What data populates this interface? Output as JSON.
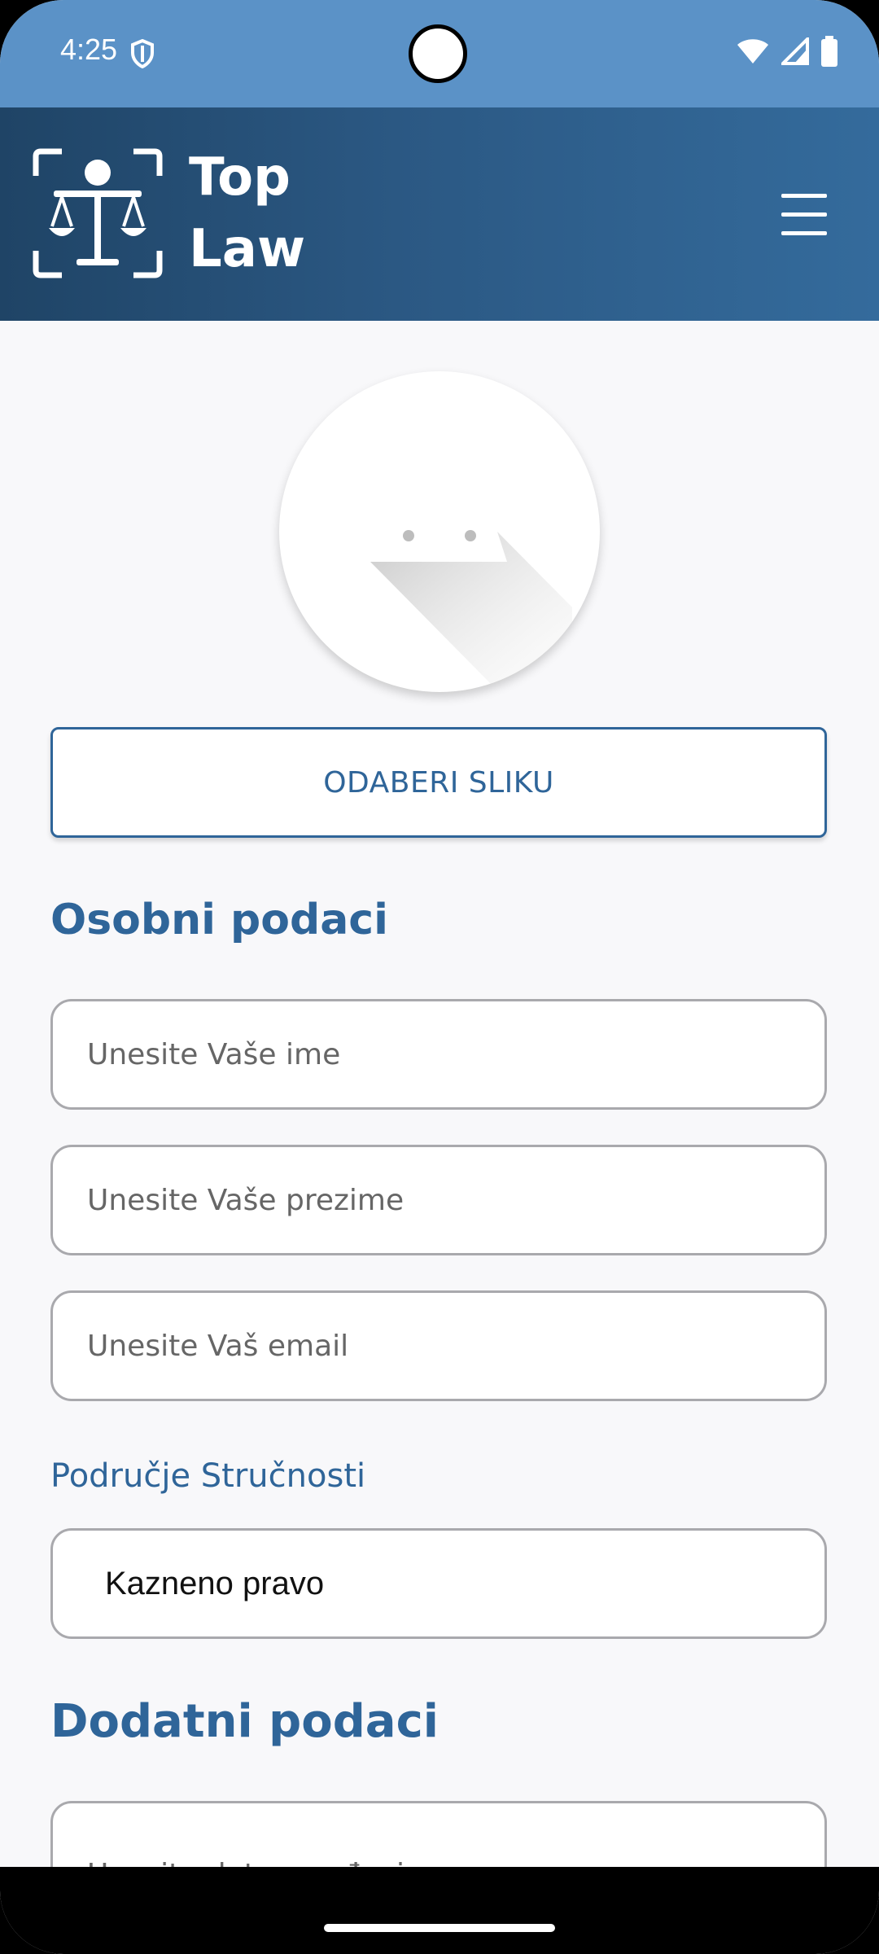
{
  "status": {
    "time": "4:25"
  },
  "app": {
    "title_line1": "Top",
    "title_line2": "Law"
  },
  "profile": {
    "pick_image_button": "ODABERI SLIKU"
  },
  "personal": {
    "title": "Osobni podaci",
    "first_name_placeholder": "Unesite Vaše ime",
    "last_name_placeholder": "Unesite Vaše prezime",
    "email_placeholder": "Unesite Vaš email"
  },
  "expertise": {
    "label": "Područje Stručnosti",
    "selected": "Kazneno pravo"
  },
  "additional": {
    "title": "Dodatni podaci",
    "birth_date_placeholder": "Unesite datum rođenja"
  },
  "colors": {
    "statusbar": "#5b92c7",
    "appbar_start": "#1f4466",
    "appbar_end": "#346b9c",
    "accent": "#2f6599"
  }
}
